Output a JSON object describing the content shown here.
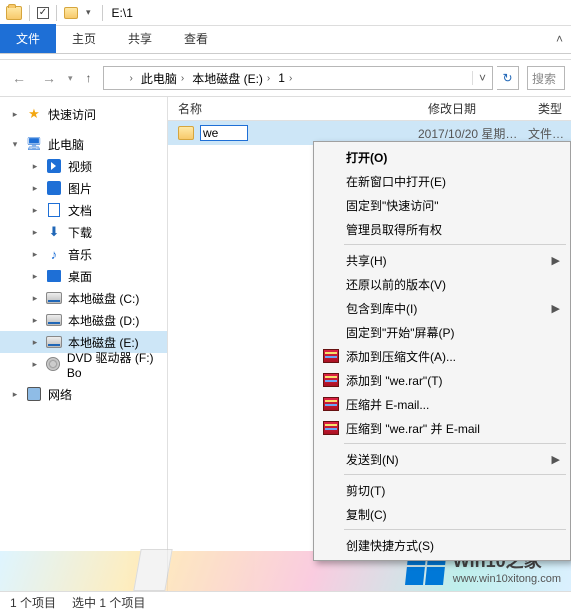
{
  "title": "E:\\1",
  "ribbon": {
    "file": "文件",
    "home": "主页",
    "share": "共享",
    "view": "查看"
  },
  "breadcrumb": {
    "items": [
      "此电脑",
      "本地磁盘 (E:)",
      "1"
    ]
  },
  "search": {
    "placeholder": "搜索"
  },
  "columns": {
    "name": "名称",
    "date": "修改日期",
    "type": "类型"
  },
  "file": {
    "rename_value": "we",
    "date": "2017/10/20 星期…",
    "type": "文件…"
  },
  "sidebar": {
    "quick": "快速访问",
    "pc": "此电脑",
    "video": "视频",
    "pictures": "图片",
    "documents": "文档",
    "downloads": "下载",
    "music": "音乐",
    "desktop": "桌面",
    "driveC": "本地磁盘 (C:)",
    "driveD": "本地磁盘 (D:)",
    "driveE": "本地磁盘 (E:)",
    "dvd": "DVD 驱动器 (F:) Bo",
    "network": "网络"
  },
  "context": {
    "open": "打开(O)",
    "new_window": "在新窗口中打开(E)",
    "pin_quick": "固定到\"快速访问\"",
    "admin_owner": "管理员取得所有权",
    "share": "共享(H)",
    "restore": "还原以前的版本(V)",
    "include_lib": "包含到库中(I)",
    "pin_start": "固定到\"开始\"屏幕(P)",
    "rar_add": "添加到压缩文件(A)...",
    "rar_add_we": "添加到 \"we.rar\"(T)",
    "rar_email": "压缩并 E-mail...",
    "rar_we_email": "压缩到 \"we.rar\" 并 E-mail",
    "sendto": "发送到(N)",
    "cut": "剪切(T)",
    "copy": "复制(C)",
    "shortcut": "创建快捷方式(S)"
  },
  "status": {
    "count": "1 个项目",
    "selected": "选中 1 个项目"
  },
  "watermark": {
    "brand_a": "Win10",
    "brand_b": "之家",
    "url": "www.win10xitong.com"
  }
}
